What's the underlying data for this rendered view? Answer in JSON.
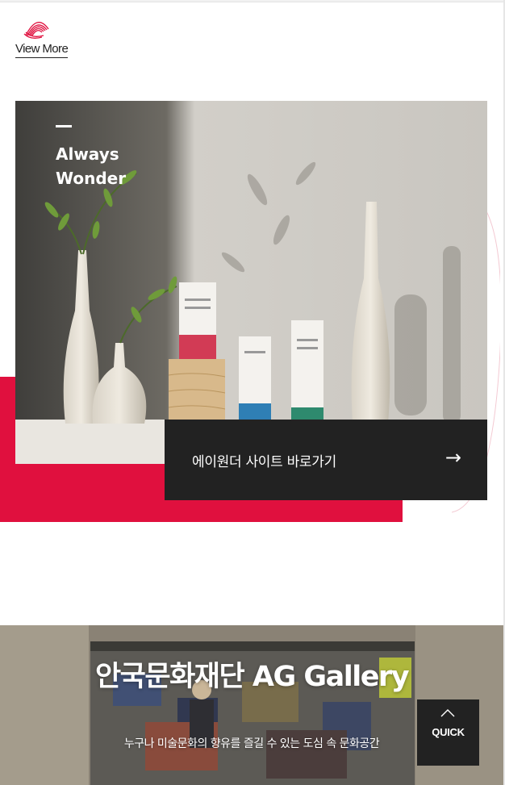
{
  "brand": {
    "logo_icon": "sunburst-logo-icon",
    "view_more_label": "View More",
    "accent_color": "#e0103e"
  },
  "promo": {
    "tagline_line1": "Always",
    "tagline_line2": "Wonder",
    "link_label": "에이원더 사이트 바로가기",
    "link_arrow": "→",
    "link_icon": "arrow-right-icon"
  },
  "gallery": {
    "title": "안국문화재단 AG Gallery",
    "subtitle": "누구나 미술문화의 향유를 즐길 수 있는 도심 속 문화공간"
  },
  "quick_menu": {
    "label": "QUICK",
    "icon": "chevron-up-icon"
  }
}
